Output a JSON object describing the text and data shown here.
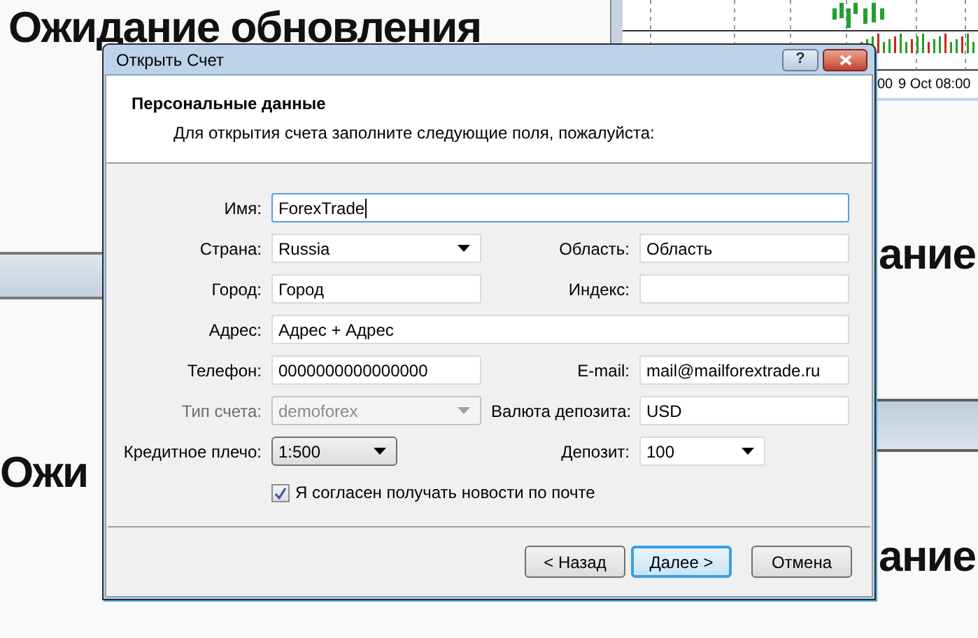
{
  "background": {
    "texts": [
      {
        "text": "Ожидание обновления",
        "kind": "top"
      },
      {
        "text": "ание",
        "kind": "right_upper"
      },
      {
        "text": "Ожи",
        "kind": "left"
      },
      {
        "text": "ание",
        "kind": "right_lower"
      }
    ],
    "chart_labels": [
      "00",
      "9 Oct 08:00"
    ]
  },
  "dialog": {
    "title": "Открыть Счет",
    "help_button": "?",
    "header": {
      "title": "Персональные данные",
      "subtitle": "Для открытия счета заполните следующие поля, пожалуйста:"
    },
    "rows": [
      [
        {
          "label": "Имя:",
          "value": "ForexTrade",
          "kind": "wide",
          "focused": true
        }
      ],
      [
        {
          "label": "Страна:",
          "value": "Russia",
          "kind": "combo"
        },
        {
          "label": "Область:",
          "value": "Область",
          "kind": "text"
        }
      ],
      [
        {
          "label": "Город:",
          "value": "Город",
          "kind": "text"
        },
        {
          "label": "Индекс:",
          "kind": "text"
        }
      ],
      [
        {
          "label": "Адрес:",
          "value": "Адрес + Адрес",
          "kind": "wide"
        }
      ],
      [
        {
          "label": "Телефон:",
          "value": "0000000000000000",
          "kind": "text"
        },
        {
          "label": "E-mail:",
          "value": "mail@mailforextrade.ru",
          "kind": "text"
        }
      ],
      [
        {
          "label": "Тип счета:",
          "value": "demoforex",
          "kind": "combo",
          "disabled": true
        },
        {
          "label": "Валюта депозита:",
          "value": "USD",
          "kind": "text"
        }
      ],
      [
        {
          "label": "Кредитное плечо:",
          "value": "1:500",
          "kind": "list_combo"
        },
        {
          "label": "Депозит:",
          "value": "100",
          "kind": "short_combo"
        }
      ]
    ],
    "checkbox": {
      "label": "Я согласен получать новости по почте",
      "checked": true
    },
    "buttons": [
      {
        "label": "< Назад",
        "default": false
      },
      {
        "label": "Далее >",
        "default": true
      },
      {
        "label": "Отмена",
        "default": false
      }
    ]
  }
}
